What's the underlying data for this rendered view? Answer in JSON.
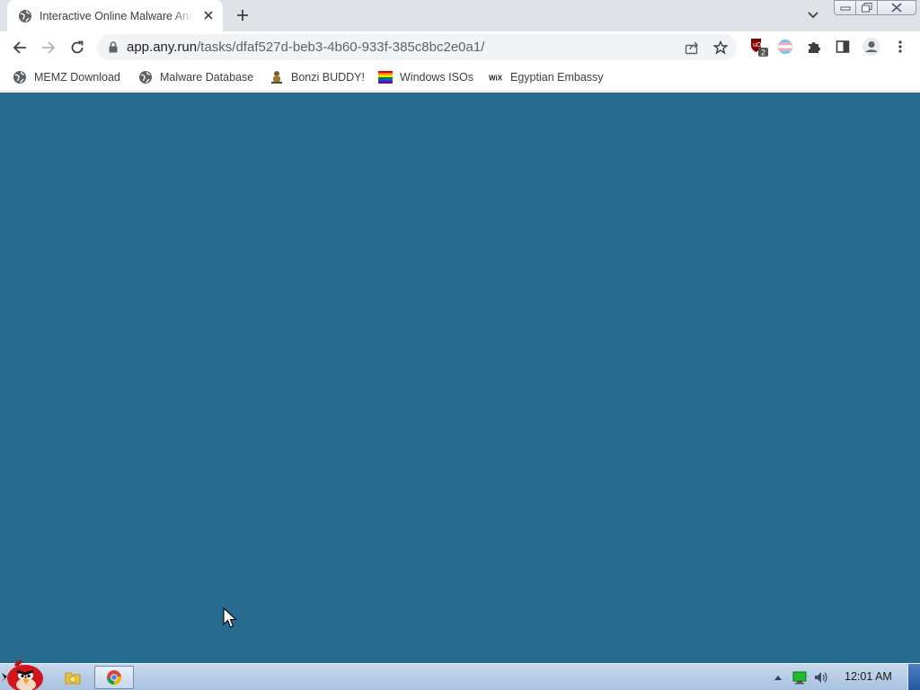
{
  "browser": {
    "tab": {
      "title": "Interactive Online Malware Analysis Sandbox",
      "favicon": "globe-icon",
      "close_icon": "close-icon"
    },
    "new_tab_icon": "plus-icon",
    "tab_search_icon": "chevron-down-icon",
    "window_controls": [
      "minimize-icon",
      "restore-icon",
      "close-icon"
    ]
  },
  "toolbar": {
    "back_icon": "arrow-left-icon",
    "forward_icon": "arrow-right-icon",
    "reload_icon": "reload-icon",
    "url_host": "app.any.run",
    "url_path": "/tasks/dfaf527d-beb3-4b60-933f-385c8bc2e0a1/",
    "share_icon": "share-icon",
    "bookmark_icon": "star-icon",
    "extensions": [
      {
        "name": "ublock-icon",
        "badge": "2"
      },
      {
        "name": "flag-icon"
      },
      {
        "name": "puzzle-icon"
      },
      {
        "name": "side-panel-icon"
      },
      {
        "name": "profile-icon"
      },
      {
        "name": "kebab-menu-icon"
      }
    ]
  },
  "bookmarks": [
    {
      "label": "MEMZ Download",
      "icon": "globe-icon"
    },
    {
      "label": "Malware Database",
      "icon": "globe-icon"
    },
    {
      "label": "Bonzi BUDDY!",
      "icon": "bonzi-icon"
    },
    {
      "label": "Windows ISOs",
      "icon": "rainbow-flag-icon"
    },
    {
      "label": "Egyptian Embassy",
      "icon": "wix-icon"
    }
  ],
  "page": {
    "background_color": "#276b8e"
  },
  "taskbar": {
    "start_icon": "angry-bird-icon",
    "apps": [
      "explorer-icon",
      "chrome-icon"
    ],
    "tray": [
      "show-hidden-icons",
      "network-icon",
      "volume-icon"
    ],
    "clock": "12:01 AM"
  }
}
